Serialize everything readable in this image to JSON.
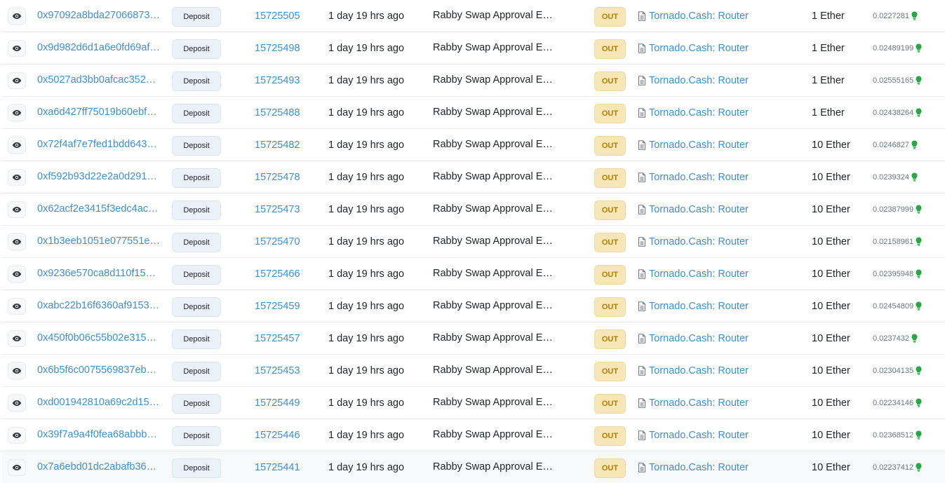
{
  "table": {
    "rows": [
      {
        "hash": "0x97092a8bda27066873…",
        "method": "Deposit",
        "block": "15725505",
        "age": "1 day 19 hrs ago",
        "from": "Rabby Swap Approval E…",
        "direction": "OUT",
        "to": "Tornado.Cash: Router",
        "value": "1 Ether",
        "fee": "0.0227281"
      },
      {
        "hash": "0x9d982d6d1a6e0fd69af…",
        "method": "Deposit",
        "block": "15725498",
        "age": "1 day 19 hrs ago",
        "from": "Rabby Swap Approval E…",
        "direction": "OUT",
        "to": "Tornado.Cash: Router",
        "value": "1 Ether",
        "fee": "0.02489199"
      },
      {
        "hash": "0x5027ad3bb0afcac352…",
        "method": "Deposit",
        "block": "15725493",
        "age": "1 day 19 hrs ago",
        "from": "Rabby Swap Approval E…",
        "direction": "OUT",
        "to": "Tornado.Cash: Router",
        "value": "1 Ether",
        "fee": "0.02555165"
      },
      {
        "hash": "0xa6d427ff75019b60ebf…",
        "method": "Deposit",
        "block": "15725488",
        "age": "1 day 19 hrs ago",
        "from": "Rabby Swap Approval E…",
        "direction": "OUT",
        "to": "Tornado.Cash: Router",
        "value": "1 Ether",
        "fee": "0.02438264"
      },
      {
        "hash": "0x72f4af7e7fed1bdd643…",
        "method": "Deposit",
        "block": "15725482",
        "age": "1 day 19 hrs ago",
        "from": "Rabby Swap Approval E…",
        "direction": "OUT",
        "to": "Tornado.Cash: Router",
        "value": "10 Ether",
        "fee": "0.0246827"
      },
      {
        "hash": "0xf592b93d22e2a0d291…",
        "method": "Deposit",
        "block": "15725478",
        "age": "1 day 19 hrs ago",
        "from": "Rabby Swap Approval E…",
        "direction": "OUT",
        "to": "Tornado.Cash: Router",
        "value": "10 Ether",
        "fee": "0.0239324"
      },
      {
        "hash": "0x62acf2e3415f3edc4ac…",
        "method": "Deposit",
        "block": "15725473",
        "age": "1 day 19 hrs ago",
        "from": "Rabby Swap Approval E…",
        "direction": "OUT",
        "to": "Tornado.Cash: Router",
        "value": "10 Ether",
        "fee": "0.02387999"
      },
      {
        "hash": "0x1b3eeb1051e077551e…",
        "method": "Deposit",
        "block": "15725470",
        "age": "1 day 19 hrs ago",
        "from": "Rabby Swap Approval E…",
        "direction": "OUT",
        "to": "Tornado.Cash: Router",
        "value": "10 Ether",
        "fee": "0.02158961"
      },
      {
        "hash": "0x9236e570ca8d110f15…",
        "method": "Deposit",
        "block": "15725466",
        "age": "1 day 19 hrs ago",
        "from": "Rabby Swap Approval E…",
        "direction": "OUT",
        "to": "Tornado.Cash: Router",
        "value": "10 Ether",
        "fee": "0.02395948"
      },
      {
        "hash": "0xabc22b16f6360af9153…",
        "method": "Deposit",
        "block": "15725459",
        "age": "1 day 19 hrs ago",
        "from": "Rabby Swap Approval E…",
        "direction": "OUT",
        "to": "Tornado.Cash: Router",
        "value": "10 Ether",
        "fee": "0.02454809"
      },
      {
        "hash": "0x450f0b06c55b02e315…",
        "method": "Deposit",
        "block": "15725457",
        "age": "1 day 19 hrs ago",
        "from": "Rabby Swap Approval E…",
        "direction": "OUT",
        "to": "Tornado.Cash: Router",
        "value": "10 Ether",
        "fee": "0.0237432"
      },
      {
        "hash": "0x6b5f6c0075569837eb…",
        "method": "Deposit",
        "block": "15725453",
        "age": "1 day 19 hrs ago",
        "from": "Rabby Swap Approval E…",
        "direction": "OUT",
        "to": "Tornado.Cash: Router",
        "value": "10 Ether",
        "fee": "0.02304135"
      },
      {
        "hash": "0xd001942810a69c2d15…",
        "method": "Deposit",
        "block": "15725449",
        "age": "1 day 19 hrs ago",
        "from": "Rabby Swap Approval E…",
        "direction": "OUT",
        "to": "Tornado.Cash: Router",
        "value": "10 Ether",
        "fee": "0.02234146"
      },
      {
        "hash": "0x39f7a9a4f0fea68abbb…",
        "method": "Deposit",
        "block": "15725446",
        "age": "1 day 19 hrs ago",
        "from": "Rabby Swap Approval E…",
        "direction": "OUT",
        "to": "Tornado.Cash: Router",
        "value": "10 Ether",
        "fee": "0.02368512"
      },
      {
        "hash": "0x7a6ebd01dc2abafb36…",
        "method": "Deposit",
        "block": "15725441",
        "age": "1 day 19 hrs ago",
        "from": "Rabby Swap Approval E…",
        "direction": "OUT",
        "to": "Tornado.Cash: Router",
        "value": "10 Ether",
        "fee": "0.02237412"
      }
    ],
    "icons": {
      "preview": "eye-icon",
      "contract": "document-icon",
      "gas": "bulb-icon"
    },
    "colors": {
      "link": "#3e8fcf",
      "out_badge_bg": "#f7e6b8",
      "out_badge_text": "#b47d00",
      "method_bg": "#eaf1f8",
      "gas_icon": "#28a745"
    }
  }
}
